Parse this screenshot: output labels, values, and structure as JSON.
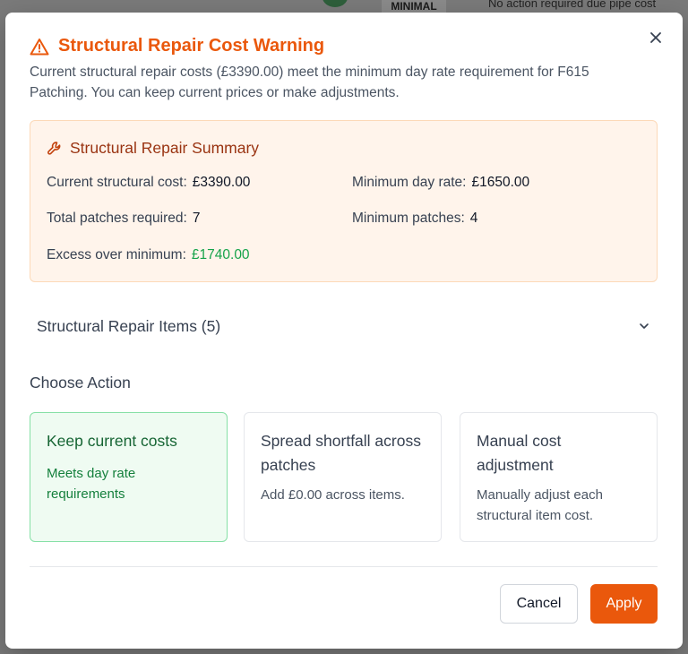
{
  "background": {
    "badge": "MINIMAL",
    "top_text": "No action required due pipe cost"
  },
  "modal": {
    "title": "Structural Repair Cost Warning",
    "description": "Current structural repair costs (£3390.00) meet the minimum day rate requirement for F615 Patching. You can keep current prices or make adjustments.",
    "close_icon": "close-icon",
    "warning_icon": "warning-triangle-icon",
    "accent_color": "#ea580c"
  },
  "summary": {
    "title": "Structural Repair Summary",
    "icon": "wrench-icon",
    "current_cost_label": "Current structural cost:",
    "current_cost_value": "£3390.00",
    "min_day_rate_label": "Minimum day rate:",
    "min_day_rate_value": "£1650.00",
    "total_patches_label": "Total patches required:",
    "total_patches_value": "7",
    "min_patches_label": "Minimum patches:",
    "min_patches_value": "4",
    "excess_label": "Excess over minimum:",
    "excess_value": "£1740.00"
  },
  "items": {
    "label": "Structural Repair Items (5)",
    "icon": "chevron-down-icon"
  },
  "actions": {
    "heading": "Choose Action",
    "options": [
      {
        "title": "Keep current costs",
        "description": "Meets day rate requirements",
        "selected": true
      },
      {
        "title": "Spread shortfall across patches",
        "description": "Add £0.00 across items.",
        "selected": false
      },
      {
        "title": "Manual cost adjustment",
        "description": "Manually adjust each structural item cost.",
        "selected": false
      }
    ]
  },
  "footer": {
    "cancel_label": "Cancel",
    "apply_label": "Apply"
  }
}
